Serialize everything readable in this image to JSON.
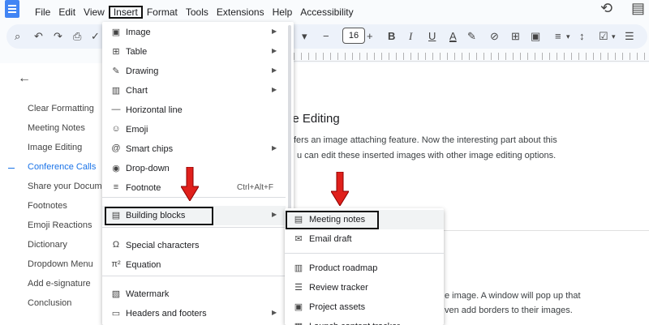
{
  "menubar": {
    "items": [
      "File",
      "Edit",
      "View",
      "Insert",
      "Format",
      "Tools",
      "Extensions",
      "Help",
      "Accessibility"
    ],
    "active_index": 3
  },
  "toolbar": {
    "font_size": "16",
    "minus": "−",
    "plus": "+",
    "bold": "B",
    "italic": "I",
    "underline": "U",
    "text_color": "A"
  },
  "outline": {
    "items": [
      "Clear Formatting",
      "Meeting Notes",
      "Image Editing",
      "Conference Calls",
      "Share your Document",
      "Footnotes",
      "Emoji Reactions",
      "Dictionary",
      "Dropdown Menu",
      "Add e-signature",
      "Conclusion"
    ],
    "active_index": 3
  },
  "document": {
    "heading": "ge Editing",
    "line1": "fers an image attaching feature. Now the interesting part about this",
    "line2": "u can edit these inserted images with other image editing options.",
    "line3": "e image. A window will pop up that",
    "line4": "ven add borders to their images."
  },
  "insert_menu": {
    "items": [
      {
        "label": "Image",
        "icon": "image-icon",
        "glyph": "▣",
        "submenu": true
      },
      {
        "label": "Table",
        "icon": "table-icon",
        "glyph": "⊞",
        "submenu": true
      },
      {
        "label": "Drawing",
        "icon": "drawing-icon",
        "glyph": "✎",
        "submenu": true
      },
      {
        "label": "Chart",
        "icon": "chart-icon",
        "glyph": "▥",
        "submenu": true
      },
      {
        "label": "Horizontal line",
        "icon": "horizontal-line-icon",
        "glyph": "—",
        "submenu": false
      },
      {
        "label": "Emoji",
        "icon": "emoji-icon",
        "glyph": "☺",
        "submenu": false
      },
      {
        "label": "Smart chips",
        "icon": "smart-chips-icon",
        "glyph": "@",
        "submenu": true
      },
      {
        "label": "Drop-down",
        "icon": "dropdown-icon",
        "glyph": "◉",
        "submenu": false
      },
      {
        "label": "Footnote",
        "icon": "footnote-icon",
        "glyph": "≡",
        "submenu": false,
        "shortcut": "Ctrl+Alt+F"
      },
      {
        "label": "Building blocks",
        "icon": "building-blocks-icon",
        "glyph": "▤",
        "submenu": true
      },
      {
        "label": "Special characters",
        "icon": "special-characters-icon",
        "glyph": "Ω",
        "submenu": false
      },
      {
        "label": "Equation",
        "icon": "equation-icon",
        "glyph": "π²",
        "submenu": false
      },
      {
        "label": "Watermark",
        "icon": "watermark-icon",
        "glyph": "▧",
        "submenu": false
      },
      {
        "label": "Headers and footers",
        "icon": "headers-footers-icon",
        "glyph": "▭",
        "submenu": true
      }
    ]
  },
  "building_blocks_menu": {
    "items": [
      {
        "label": "Meeting notes",
        "icon": "meeting-notes-icon",
        "glyph": "▤"
      },
      {
        "label": "Email draft",
        "icon": "email-draft-icon",
        "glyph": "✉"
      },
      {
        "label": "Product roadmap",
        "icon": "product-roadmap-icon",
        "glyph": "▥"
      },
      {
        "label": "Review tracker",
        "icon": "review-tracker-icon",
        "glyph": "☰"
      },
      {
        "label": "Project assets",
        "icon": "project-assets-icon",
        "glyph": "▣"
      },
      {
        "label": "Launch content tracker",
        "icon": "launch-tracker-icon",
        "glyph": "▦"
      }
    ]
  },
  "colors": {
    "accent": "#1a73e8",
    "arrow": "#e0201b",
    "highlight": "#f1f3f4"
  }
}
